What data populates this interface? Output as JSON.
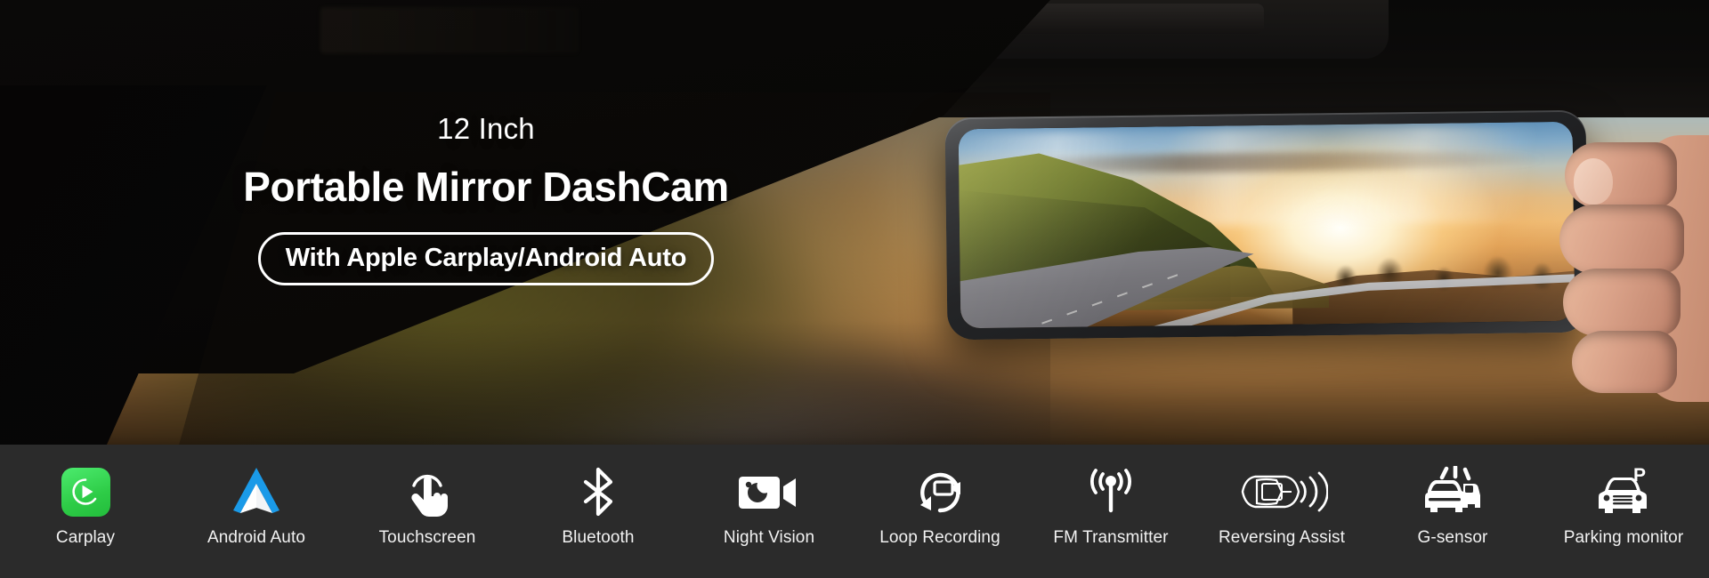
{
  "hero": {
    "kicker": "12 Inch",
    "headline": "Portable Mirror DashCam",
    "badge": "With Apple Carplay/Android Auto",
    "device_alt": "12 inch mirror dashcam displaying a sunset mountain road",
    "hand_alt": "hand holding the mirror dashcam"
  },
  "colors": {
    "bar_background": "#2b2b2b",
    "label_text": "#f2f2f2",
    "carplay_green": "#2ecc47",
    "android_blue": "#1a9ae8",
    "icon_white": "#ffffff",
    "badge_border": "#ffffff"
  },
  "feature_bar": {
    "items": [
      {
        "label": "Carplay",
        "icon": "carplay-icon"
      },
      {
        "label": "Android Auto",
        "icon": "android-auto-icon"
      },
      {
        "label": "Touchscreen",
        "icon": "touch-hand-icon"
      },
      {
        "label": "Bluetooth",
        "icon": "bluetooth-icon"
      },
      {
        "label": "Night Vision",
        "icon": "night-vision-camera-icon"
      },
      {
        "label": "Loop Recording",
        "icon": "loop-recording-icon"
      },
      {
        "label": "FM Transmitter",
        "icon": "fm-antenna-icon"
      },
      {
        "label": "Reversing Assist",
        "icon": "reversing-car-waves-icon"
      },
      {
        "label": "G-sensor",
        "icon": "collision-cars-icon"
      },
      {
        "label": "Parking monitor",
        "icon": "parking-car-p-icon"
      }
    ]
  }
}
